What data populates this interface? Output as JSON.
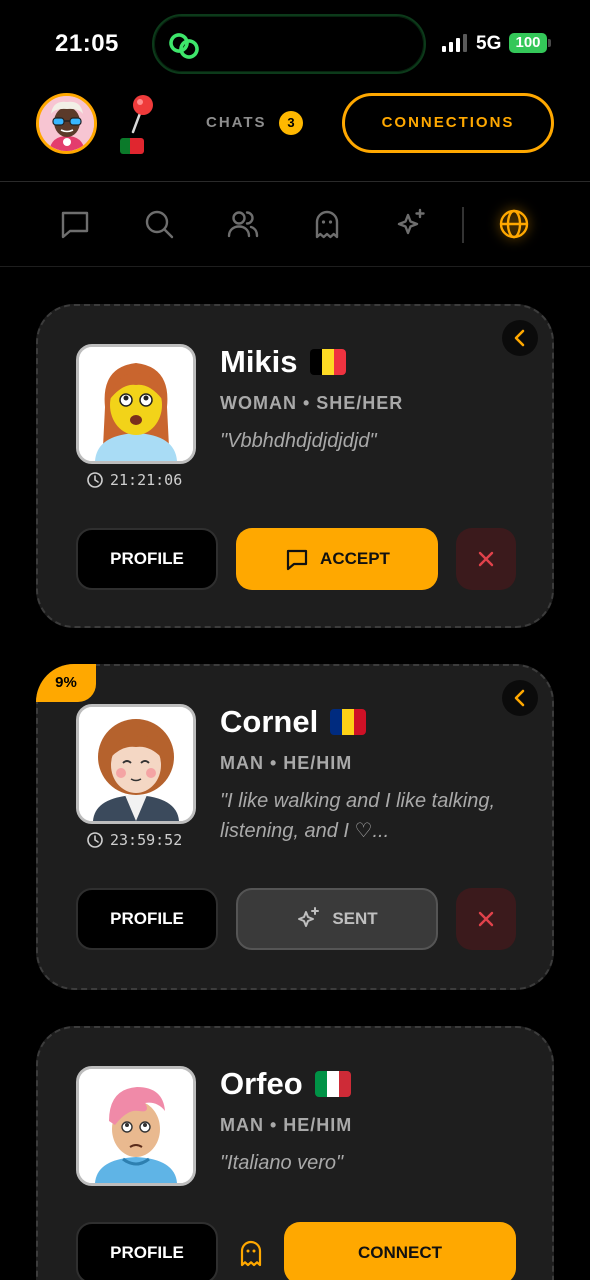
{
  "status_bar": {
    "time": "21:05",
    "network": "5G",
    "battery": "100"
  },
  "header": {
    "chats_label": "CHATS",
    "chats_count": "3",
    "connections_label": "CONNECTIONS"
  },
  "tabs": [
    {
      "icon": "chat-bubble-icon",
      "active": false
    },
    {
      "icon": "search-icon",
      "active": false
    },
    {
      "icon": "users-icon",
      "active": false
    },
    {
      "icon": "ghost-icon",
      "active": false
    },
    {
      "icon": "sparkles-icon",
      "active": false
    },
    {
      "icon": "globe-icon",
      "active": true
    }
  ],
  "colors": {
    "accent": "#ffa800",
    "card": "#1e1e1e",
    "danger": "#e0424b"
  },
  "cards": [
    {
      "name": "Mikis",
      "flag": "belgium",
      "meta": "WOMAN • SHE/HER",
      "quote": "\"Vbbhdhdjdjdjdjd\"",
      "timer": "21:21:06",
      "profile_label": "PROFILE",
      "action_label": "ACCEPT"
    },
    {
      "name": "Cornel",
      "flag": "romania",
      "meta": "MAN • HE/HIM",
      "quote": "\"I like walking and I like talking, listening, and I ♡...",
      "timer": "23:59:52",
      "match_pct": "9%",
      "profile_label": "PROFILE",
      "action_label": "SENT"
    },
    {
      "name": "Orfeo",
      "flag": "italy",
      "meta": "MAN • HE/HIM",
      "quote": "\"Italiano vero\"",
      "profile_label": "PROFILE",
      "action_label": "CONNECT"
    }
  ]
}
